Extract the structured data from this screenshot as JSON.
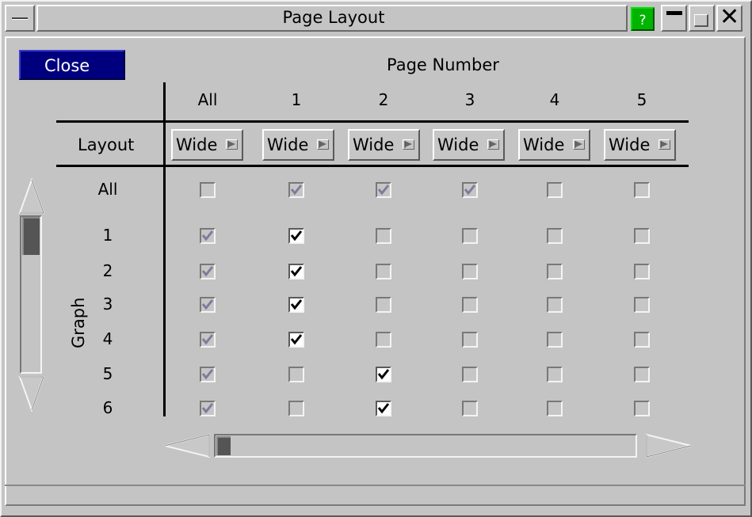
{
  "window": {
    "title": "Page Layout",
    "help_label": "?",
    "colors": {
      "help_green": "#00b400",
      "close_blue": "#00007e",
      "background": "#c4c4c4"
    }
  },
  "close_label": "Close",
  "page_number_label": "Page Number",
  "columns": [
    "All",
    "1",
    "2",
    "3",
    "4",
    "5"
  ],
  "layout": {
    "label": "Layout",
    "values": [
      "Wide",
      "Wide",
      "Wide",
      "Wide",
      "Wide",
      "Wide"
    ]
  },
  "graph_label": "Graph",
  "rows": [
    {
      "label": "All",
      "states": [
        "off",
        "gray",
        "gray",
        "gray",
        "off",
        "off"
      ]
    },
    {
      "label": "1",
      "states": [
        "gray",
        "on",
        "off",
        "off",
        "off",
        "off"
      ]
    },
    {
      "label": "2",
      "states": [
        "gray",
        "on",
        "off",
        "off",
        "off",
        "off"
      ]
    },
    {
      "label": "3",
      "states": [
        "gray",
        "on",
        "off",
        "off",
        "off",
        "off"
      ]
    },
    {
      "label": "4",
      "states": [
        "gray",
        "on",
        "off",
        "off",
        "off",
        "off"
      ]
    },
    {
      "label": "5",
      "states": [
        "gray",
        "off",
        "on",
        "off",
        "off",
        "off"
      ]
    },
    {
      "label": "6",
      "states": [
        "gray",
        "off",
        "on",
        "off",
        "off",
        "off"
      ]
    }
  ],
  "icons": {
    "system_menu": "system-menu-icon",
    "minimize": "minimize-icon",
    "maximize": "maximize-icon",
    "close": "close-x-icon",
    "dropdown_flag": "flag-icon",
    "scroll_up": "arrow-up-icon",
    "scroll_down": "arrow-down-icon",
    "scroll_left": "arrow-left-icon",
    "scroll_right": "arrow-right-icon"
  }
}
